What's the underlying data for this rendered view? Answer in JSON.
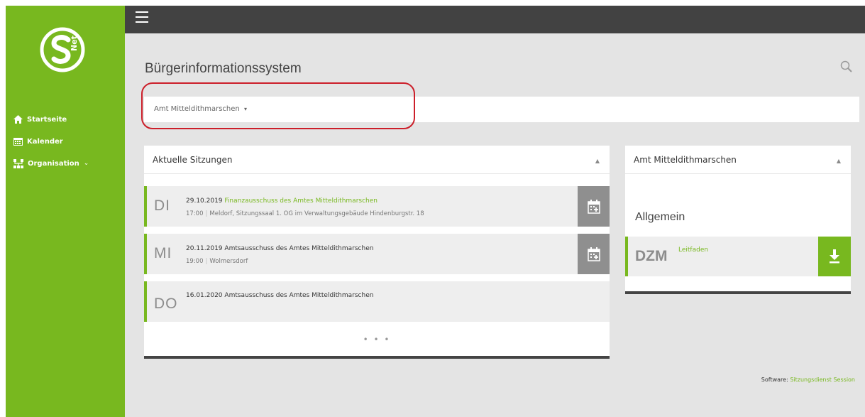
{
  "colors": {
    "brand_green": "#78b81f",
    "topbar": "#424242",
    "highlight": "#cc1f2a"
  },
  "logo": {
    "icon": "snet-logo",
    "text": "Net"
  },
  "sidebar": {
    "items": [
      {
        "label": "Startseite",
        "icon": "home-icon"
      },
      {
        "label": "Kalender",
        "icon": "calendar-icon"
      },
      {
        "label": "Organisation",
        "icon": "organisation-icon",
        "caret": "⌄"
      }
    ]
  },
  "header": {
    "title": "Bürgerinformationssystem",
    "search_icon": "search-icon"
  },
  "org_selector": {
    "value": "Amt Mitteldithmarschen",
    "caret": "▾"
  },
  "sessions_panel": {
    "title": "Aktuelle Sitzungen",
    "collapse": "▲",
    "sessions": [
      {
        "day": "DI",
        "date": "29.10.2019",
        "title": "Finanzausschuss des Amtes Mitteldithmarschen",
        "time": "17:00",
        "location": "Meldorf, Sitzungssaal 1. OG im Verwaltungsgebäude Hindenburgstr. 18"
      },
      {
        "day": "MI",
        "date": "20.11.2019",
        "title": "Amtsausschuss des Amtes Mitteldithmarschen",
        "time": "19:00",
        "location": "Wolmersdorf"
      },
      {
        "day": "DO",
        "date": "16.01.2020",
        "title": "Amtsausschuss des Amtes Mitteldithmarschen"
      }
    ],
    "more": "• • •"
  },
  "org_panel": {
    "title": "Amt Mitteldithmarschen",
    "collapse": "▲",
    "section": "Allgemein",
    "doc": {
      "abbr": "DZM",
      "label": "Leitfaden"
    }
  },
  "footer": {
    "label": "Software:",
    "link": "Sitzungsdienst Session"
  }
}
